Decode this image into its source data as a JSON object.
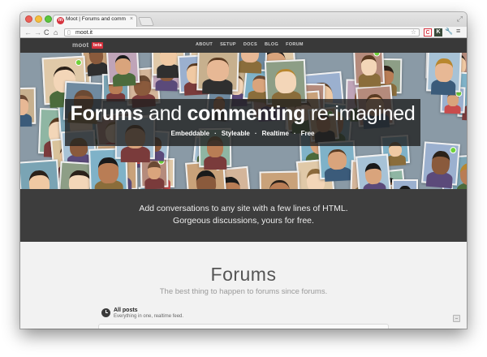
{
  "browser": {
    "tab_title": "Moot | Forums and comme",
    "tab_favicon": "m",
    "url": "moot.it",
    "extensions": [
      "C",
      "K"
    ]
  },
  "site_nav": {
    "logo": "moot",
    "badge": "beta",
    "links": [
      "ABOUT",
      "SETUP",
      "DOCS",
      "BLOG",
      "FORUM"
    ]
  },
  "hero": {
    "title_bold_1": "Forums",
    "title_light_1": " and ",
    "title_bold_2": "commenting",
    "title_light_2": " re-imagined",
    "features": [
      "Embeddable",
      "Styleable",
      "Realtime",
      "Free"
    ]
  },
  "tagline": {
    "line1": "Add conversations to any site with a few lines of HTML.",
    "line2": "Gorgeous discussions, yours for free."
  },
  "forums_section": {
    "title": "Forums",
    "subtitle": "The best thing to happen to forums since forums.",
    "feed_title": "All posts",
    "feed_subtitle": "Everything in one, realtime feed."
  },
  "colors": {
    "brand_red": "#d6323e",
    "nav_bg": "#393939",
    "tagline_bg": "#3d3d3d",
    "section_bg": "#f2f2f2"
  },
  "icons": [
    "close-traffic-light",
    "minimize-traffic-light",
    "maximize-traffic-light",
    "back-arrow-icon",
    "forward-arrow-icon",
    "reload-icon",
    "home-icon",
    "page-icon",
    "star-icon",
    "wrench-icon",
    "menu-icon",
    "clock-icon",
    "chat-icon"
  ]
}
